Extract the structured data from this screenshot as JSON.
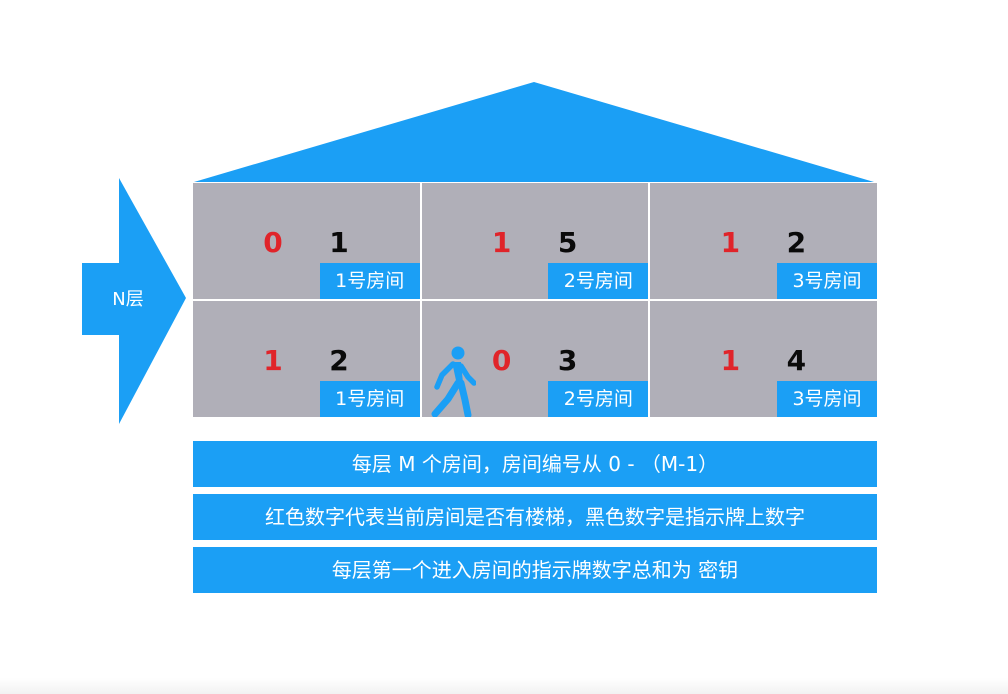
{
  "colors": {
    "accent_blue": "#1b9ff5",
    "room_gray": "#b0afb8",
    "stair_red": "#e0242a",
    "sign_black": "#0a0a0a"
  },
  "floor_label": "N层",
  "rows": [
    [
      {
        "stair": "0",
        "sign": "1",
        "tag": "1号房间"
      },
      {
        "stair": "1",
        "sign": "5",
        "tag": "2号房间"
      },
      {
        "stair": "1",
        "sign": "2",
        "tag": "3号房间"
      }
    ],
    [
      {
        "stair": "1",
        "sign": "2",
        "tag": "1号房间"
      },
      {
        "stair": "0",
        "sign": "3",
        "tag": "2号房间"
      },
      {
        "stair": "1",
        "sign": "4",
        "tag": "3号房间"
      }
    ]
  ],
  "walker_icon": "person-walking-icon",
  "notes": [
    "每层 M 个房间，房间编号从 0 - （M-1）",
    "红色数字代表当前房间是否有楼梯，黑色数字是指示牌上数字",
    "每层第一个进入房间的指示牌数字总和为 密钥"
  ]
}
